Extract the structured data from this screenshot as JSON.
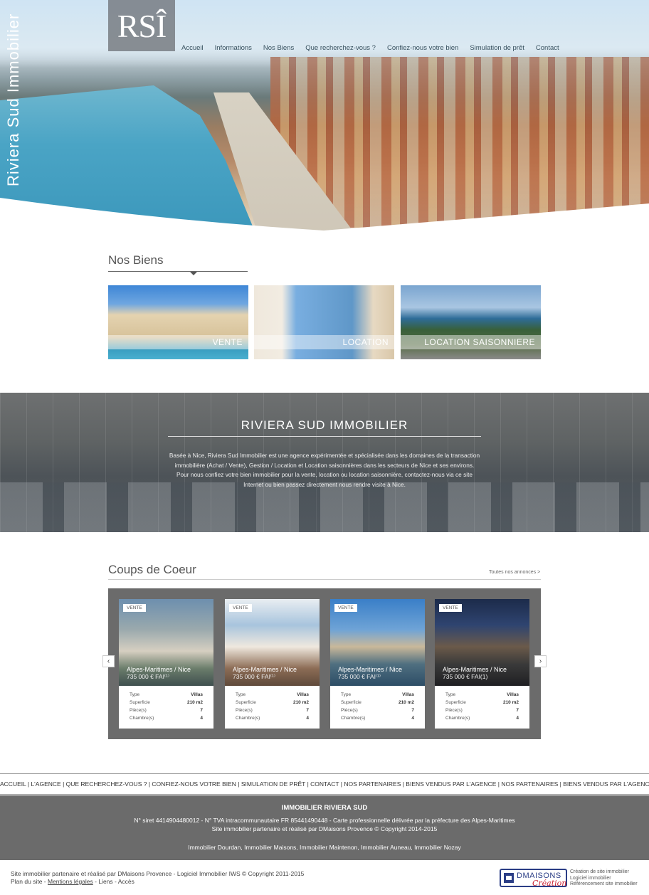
{
  "header": {
    "logo": "RSÎ",
    "vertical_title": "Riviera Sud Immobilier",
    "nav": [
      "Accueil",
      "Informations",
      "Nos Biens",
      "Que recherchez-vous ?",
      "Confiez-nous votre bien",
      "Simulation de prêt",
      "Contact"
    ]
  },
  "nos_biens": {
    "title": "Nos Biens",
    "categories": [
      "VENTE",
      "LOCATION",
      "LOCATION SAISONNIERE"
    ]
  },
  "band": {
    "title": "RIVIERA SUD IMMOBILIER",
    "p1": "Basée à Nice, Riviera Sud Immobilier est une agence expérimentée et spécialisée dans les domaines de la transaction immobilière (Achat / Vente), Gestion / Location et Location saisonnières dans les secteurs de Nice et ses environs.",
    "p2": "Pour nous confiez votre bien immobilier pour la vente, location ou location saisonnière, contactez-nous via ce site Internet ou bien passez directement nous rendre visite à Nice."
  },
  "coups": {
    "title": "Coups de Coeur",
    "all_link": "Toutes nos annonces >",
    "prev": "‹",
    "next": "›",
    "cards": [
      {
        "badge": "VENTE",
        "location": "Alpes-Maritimes / Nice",
        "price": "735 000 € FAI⁽¹⁾",
        "specs": [
          [
            "Type",
            "Villas"
          ],
          [
            "Superficie",
            "210 m2"
          ],
          [
            "Pièce(s)",
            "7"
          ],
          [
            "Chambre(s)",
            "4"
          ]
        ]
      },
      {
        "badge": "VENTE",
        "location": "Alpes-Maritimes / Nice",
        "price": "735 000 € FAI⁽¹⁾",
        "specs": [
          [
            "Type",
            "Villas"
          ],
          [
            "Superficie",
            "210 m2"
          ],
          [
            "Pièce(s)",
            "7"
          ],
          [
            "Chambre(s)",
            "4"
          ]
        ]
      },
      {
        "badge": "VENTE",
        "location": "Alpes-Maritimes / Nice",
        "price": "735 000 € FAI⁽¹⁾",
        "specs": [
          [
            "Type",
            "Villas"
          ],
          [
            "Superficie",
            "210 m2"
          ],
          [
            "Pièce(s)",
            "7"
          ],
          [
            "Chambre(s)",
            "4"
          ]
        ]
      },
      {
        "badge": "VENTE",
        "location": "Alpes-Maritimes / Nice",
        "price": "735 000 € FAI(1)",
        "specs": [
          [
            "Type",
            "Villas"
          ],
          [
            "Superficie",
            "210 m2"
          ],
          [
            "Pièce(s)",
            "7"
          ],
          [
            "Chambre(s)",
            "4"
          ]
        ]
      }
    ]
  },
  "footer": {
    "nav": "ACCUEIL | L'AGENCE | QUE RECHERCHEZ-VOUS ? | CONFIEZ-NOUS VOTRE BIEN | SIMULATION DE PRÊT | CONTACT | NOS PARTENAIRES | BIENS VENDUS PAR L'AGENCE | NOS PARTENAIRES | BIENS VENDUS PAR L'AGENCE",
    "company": "IMMOBILIER RIVIERA SUD",
    "line1": "N° siret 4414904480012 - N° TVA intracommunautaire FR 85441490448 - Carte professionnelle délivrée par la préfecture des Alpes-Maritimes",
    "line2": "Site immobilier partenaire et réalisé par DMaisons Provence © Copyright 2014-2015",
    "line3": "Immobilier Dourdan, Immobilier Maisons, Immobilier Maintenon, Immobilier Auneau, Immobilier Nozay",
    "bottom1": "Site immobilier partenaire et réalisé par DMaisons Provence - Logiciel Immobilier IWS © Copyright 2011-2015",
    "plan": "Plan du site",
    "mentions": "Mentions légales",
    "liens": "Liens",
    "acces": "Accès",
    "dm_name": "DMAISONS",
    "dm_creation": "Création",
    "dm_lines": [
      "Création de site immobilier",
      "Logiciel immobilier",
      "Référencement site immobilier"
    ]
  }
}
